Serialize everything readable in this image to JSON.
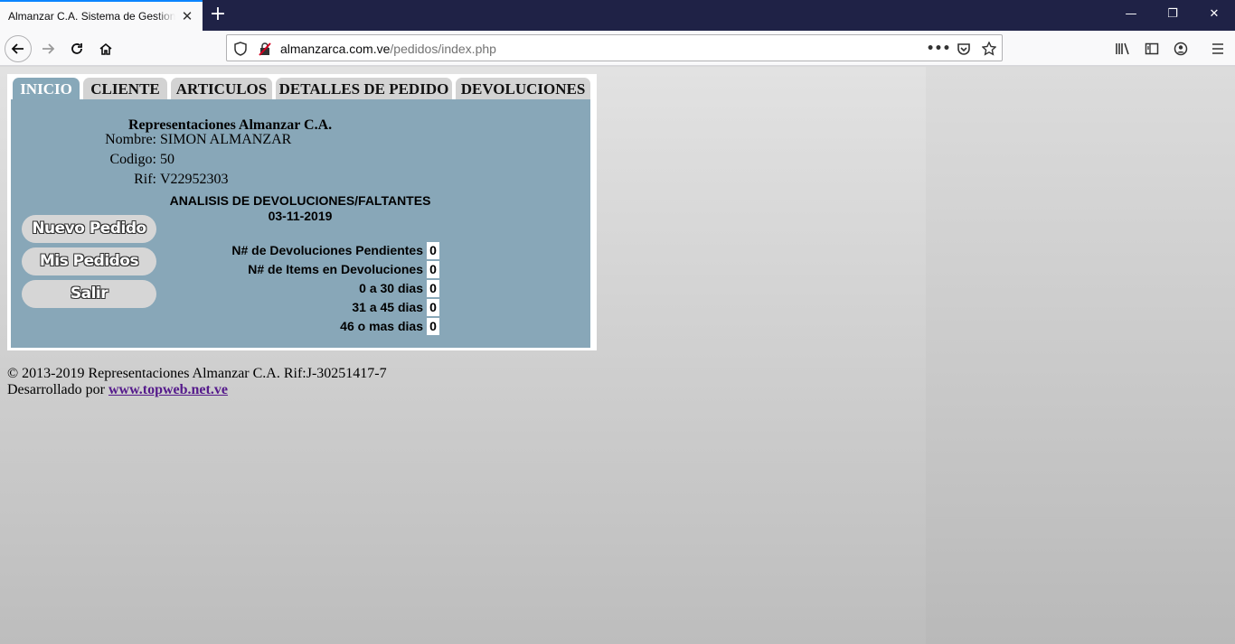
{
  "browser": {
    "tab_title": "Almanzar C.A. Sistema de Gestion de Pedidos",
    "url_domain": "almanzarca.com.ve",
    "url_path": "/pedidos/index.php",
    "accent_color": "#0a84ff"
  },
  "page": {
    "tabs": [
      {
        "label": "INICIO",
        "active": true
      },
      {
        "label": "CLIENTE",
        "active": false
      },
      {
        "label": "ARTICULOS",
        "active": false
      },
      {
        "label": "DETALLES DE PEDIDO",
        "active": false
      },
      {
        "label": "DEVOLUCIONES",
        "active": false
      }
    ],
    "company": "Representaciones Almanzar C.A.",
    "client": {
      "nombre_label": "Nombre:",
      "nombre": "SIMON ALMANZAR",
      "codigo_label": "Codigo:",
      "codigo": "50",
      "rif_label": "Rif:",
      "rif": "V22952303"
    },
    "analysis": {
      "title": "ANALISIS DE DEVOLUCIONES/FALTANTES",
      "date": "03-11-2019"
    },
    "buttons": {
      "nuevo_pedido": "Nuevo Pedido",
      "mis_pedidos": "Mis Pedidos",
      "salir": "Salir"
    },
    "stats": [
      {
        "label": "N# de Devoluciones Pendientes",
        "value": "0"
      },
      {
        "label": "N# de Items en Devoluciones",
        "value": "0"
      },
      {
        "label": "0 a 30 dias",
        "value": "0"
      },
      {
        "label": "31 a 45 dias",
        "value": "0"
      },
      {
        "label": "46 o mas dias",
        "value": "0"
      }
    ],
    "footer": {
      "copyright": "© 2013-2019 Representaciones Almanzar C.A. Rif:J-30251417-7",
      "developed_by": "Desarrollado por",
      "link": "www.topweb.net.ve"
    },
    "panel_color": "#88a7b8"
  }
}
